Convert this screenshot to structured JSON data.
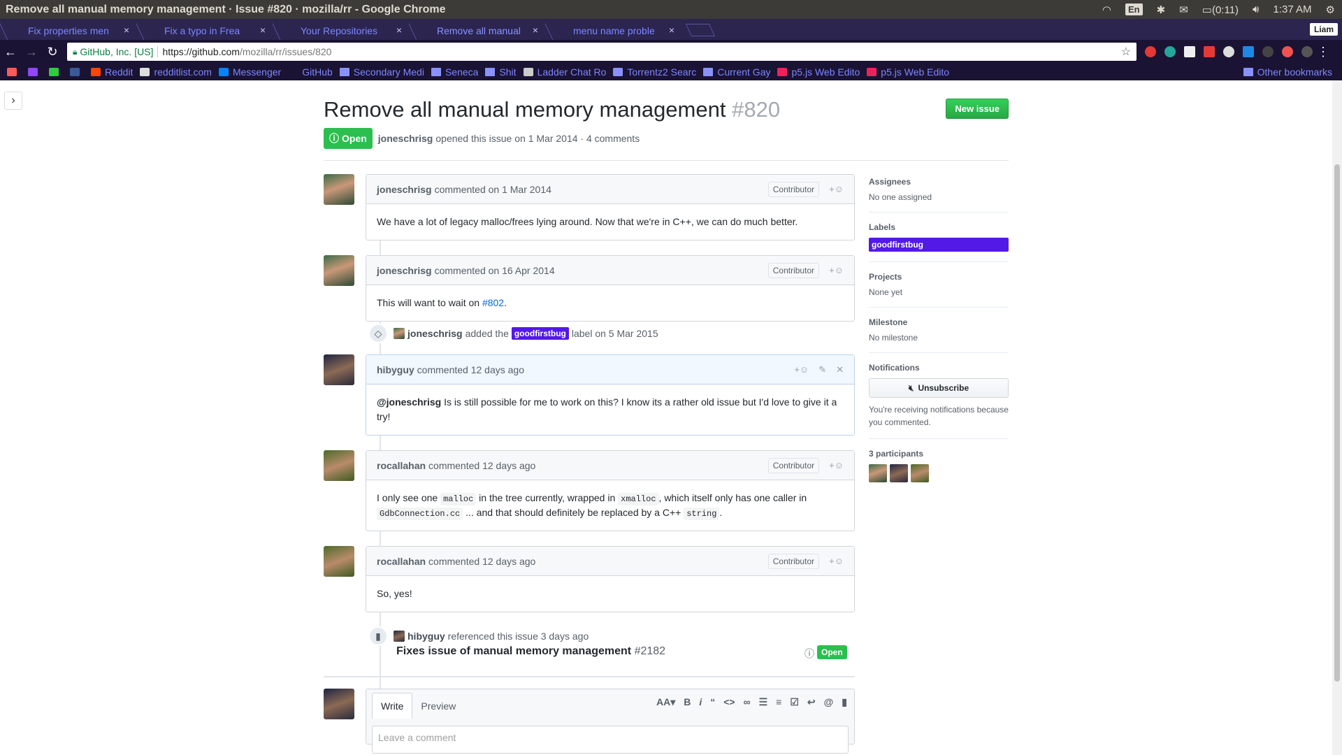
{
  "os": {
    "window_title": "Remove all manual memory management · Issue #820 · mozilla/rr - Google Chrome",
    "lang": "En",
    "battery": "(0:11)",
    "clock": "1:37 AM"
  },
  "tabs": [
    {
      "label": "Fix properties men",
      "close": "×"
    },
    {
      "label": "Fix a typo in Frea",
      "close": "×"
    },
    {
      "label": "Your Repositories",
      "close": "×"
    },
    {
      "label": "Remove all manual",
      "close": "×"
    },
    {
      "label": "menu name proble",
      "close": "×"
    }
  ],
  "profile_name": "Liam",
  "omnibox": {
    "secure_label": "GitHub, Inc. [US]",
    "url_host": "https://github.com",
    "url_path": "/mozilla/rr/issues/820"
  },
  "bookmarks": [
    {
      "label": "",
      "color": "#ff5a5a"
    },
    {
      "label": "",
      "color": "#9146ff"
    },
    {
      "label": "",
      "color": "#2ecc40"
    },
    {
      "label": "",
      "color": "#3b5998"
    },
    {
      "label": "Reddit",
      "color": "#ff4500"
    },
    {
      "label": "redditlist.com",
      "color": "#dddddd"
    },
    {
      "label": "Messenger",
      "color": "#0084ff"
    },
    {
      "label": "GitHub",
      "color": ""
    },
    {
      "label": "Secondary Medi",
      "folder": true
    },
    {
      "label": "Seneca",
      "folder": true
    },
    {
      "label": "Shit",
      "folder": true
    },
    {
      "label": "Ladder Chat Ro",
      "color": "#cccccc"
    },
    {
      "label": "Torrentz2 Searc",
      "color": "#8a92ff"
    },
    {
      "label": "Current Gay",
      "folder": true
    },
    {
      "label": "p5.js Web Edito",
      "color": "#ed225d"
    },
    {
      "label": "p5.js Web Edito",
      "color": "#ed225d"
    }
  ],
  "other_bookmarks": "Other bookmarks",
  "issue": {
    "title": "Remove all manual memory management",
    "number": "#820",
    "new_issue_label": "New issue",
    "state": "Open",
    "author": "joneschrisg",
    "opened_text": "opened this issue on 1 Mar 2014 · 4 comments"
  },
  "comments": [
    {
      "author": "joneschrisg",
      "action": "commented on 1 Mar 2014",
      "badge": "Contributor",
      "body": "We have a lot of legacy malloc/frees lying around. Now that we're in C++, we can do much better."
    },
    {
      "author": "joneschrisg",
      "action": "commented on 16 Apr 2014",
      "badge": "Contributor",
      "body_pre": "This will want to wait on ",
      "body_link": "#802",
      "body_post": "."
    },
    {
      "author": "hibyguy",
      "action": "commented 12 days ago",
      "mention": "@joneschrisg",
      "body": " Is is still possible for me to work on this? I know its a rather old issue but I'd love to give it a try!"
    },
    {
      "author": "rocallahan",
      "action": "commented 12 days ago",
      "badge": "Contributor",
      "t1": "I only see one ",
      "c1": "malloc",
      "t2": " in the tree currently, wrapped in ",
      "c2": "xmalloc",
      "t3": ", which itself only has one caller in ",
      "c3": "GdbConnection.cc",
      "t4": " ... and that should definitely be replaced by a C++ ",
      "c4": "string",
      "t5": "."
    },
    {
      "author": "rocallahan",
      "action": "commented 12 days ago",
      "badge": "Contributor",
      "body": "So, yes!"
    }
  ],
  "label_event": {
    "author": "joneschrisg",
    "pre": "added the",
    "label": "goodfirstbug",
    "post": "label on 5 Mar 2015"
  },
  "ref_event": {
    "author": "hibyguy",
    "text": "referenced this issue 3 days ago",
    "title": "Fixes issue of manual memory management",
    "number": "#2182",
    "state": "Open"
  },
  "new_comment": {
    "write_tab": "Write",
    "preview_tab": "Preview",
    "placeholder": "Leave a comment"
  },
  "sidebar": {
    "assignees_h": "Assignees",
    "assignees_v": "No one assigned",
    "labels_h": "Labels",
    "label": "goodfirstbug",
    "projects_h": "Projects",
    "projects_v": "None yet",
    "milestone_h": "Milestone",
    "milestone_v": "No milestone",
    "notifications_h": "Notifications",
    "unsubscribe": "Unsubscribe",
    "note": "You're receiving notifications because you commented.",
    "participants_h": "3 participants"
  }
}
